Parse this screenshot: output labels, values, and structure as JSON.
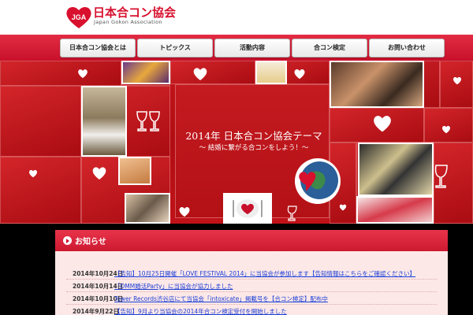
{
  "logo": {
    "badge": "JGA",
    "title": "日本合コン協会",
    "subtitle": "Japan Gokon Association"
  },
  "nav": {
    "items": [
      {
        "label": "日本合コン協会とは"
      },
      {
        "label": "トピックス"
      },
      {
        "label": "活動内容"
      },
      {
        "label": "合コン検定"
      },
      {
        "label": "お問い合わせ"
      }
    ]
  },
  "hero": {
    "title": "2014年 日本合コン協会テーマ",
    "subtitle": "〜 結婚に繋がる合コンをしよう！〜"
  },
  "news": {
    "title": "お知らせ",
    "items": [
      {
        "date": "2014年10月24日",
        "text": "【告知】10月25日開催「LOVE FESTIVAL 2014」に当協会が参加します【告知情報はこちらをご確認ください】"
      },
      {
        "date": "2014年10月14日",
        "text": "「DMM婚活Party」に当協会が協力しました"
      },
      {
        "date": "2014年10月10日",
        "text": "Tower Records渋谷店にて当協会「intoxicate」掲載号を【合コン検定】配布中"
      },
      {
        "date": "2014年9月22日",
        "text": "【告知】9月より当協会の2014年合コン検定受付を開始しました"
      }
    ]
  },
  "colors": {
    "brand_red": "#d8102e",
    "hero_red": "#c4161c",
    "news_bg": "#fde8e8",
    "link_blue": "#1a3fd6"
  }
}
